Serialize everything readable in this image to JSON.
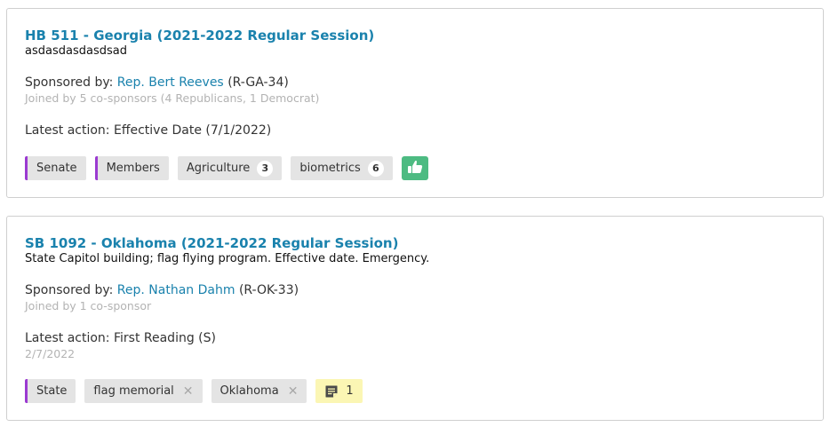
{
  "bills": [
    {
      "title": "HB 511 - Georgia (2021-2022 Regular Session)",
      "description": "asdasdasdasdsad",
      "sponsor_prefix": "Sponsored by:",
      "sponsor_name": "Rep. Bert Reeves",
      "sponsor_district": "(R-GA-34)",
      "cosponsors": "Joined by 5 co-sponsors (4 Republicans, 1 Democrat)",
      "latest_action": "Latest action: Effective Date (7/1/2022)",
      "tags": [
        {
          "label": "Senate",
          "accent": true
        },
        {
          "label": "Members",
          "accent": true
        },
        {
          "label": "Agriculture",
          "count": "3"
        },
        {
          "label": "biometrics",
          "count": "6"
        }
      ],
      "reaction_icon": "thumbs-up-icon"
    },
    {
      "title": "SB 1092 - Oklahoma (2021-2022 Regular Session)",
      "description": "State Capitol building; flag flying program. Effective date. Emergency.",
      "sponsor_prefix": "Sponsored by:",
      "sponsor_name": "Rep. Nathan Dahm",
      "sponsor_district": "(R-OK-33)",
      "cosponsors": "Joined by 1 co-sponsor",
      "latest_action": "Latest action: First Reading (S)",
      "latest_action_date": "2/7/2022",
      "tags": [
        {
          "label": "State",
          "accent": true
        },
        {
          "label": "flag memorial",
          "removable": true
        },
        {
          "label": "Oklahoma",
          "removable": true
        }
      ],
      "notes_count": "1",
      "notes_icon": "note-icon"
    }
  ],
  "colors": {
    "link": "#1a82ad",
    "accent_bar": "#9b3ad1",
    "thumb_bg": "#4dbb82",
    "note_bg": "#fbf6b4"
  }
}
